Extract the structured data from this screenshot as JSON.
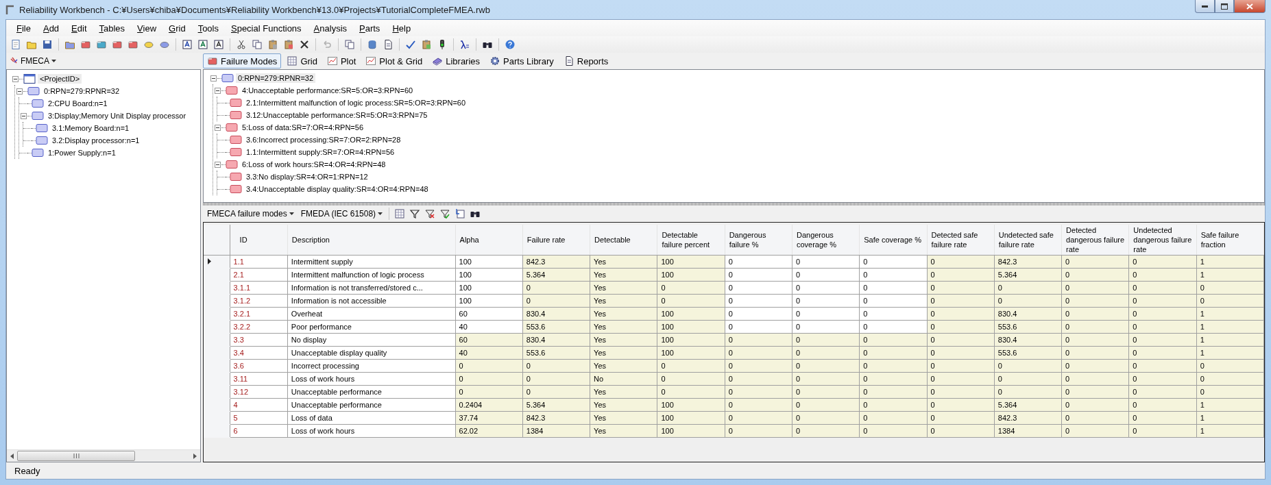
{
  "window": {
    "title": "Reliability Workbench - C:¥Users¥chiba¥Documents¥Reliability Workbench¥13.0¥Projects¥TutorialCompleteFMEA.rwb"
  },
  "menu": [
    "File",
    "Add",
    "Edit",
    "Tables",
    "View",
    "Grid",
    "Tools",
    "Special Functions",
    "Analysis",
    "Parts",
    "Help"
  ],
  "sidebar": {
    "dropdown": "FMECA",
    "tree": [
      {
        "label": "<ProjectID>",
        "kind": "project",
        "selected": true,
        "expanded": true,
        "children": [
          {
            "label": "0:RPN=279:RPNR=32",
            "kind": "block",
            "selected": false,
            "expanded": true,
            "children": [
              {
                "label": "2:CPU Board:n=1",
                "kind": "block",
                "selected": false
              },
              {
                "label": "3:Display;Memory Unit Display processor",
                "kind": "block",
                "selected": false,
                "expanded": true,
                "children": [
                  {
                    "label": "3.1:Memory Board:n=1",
                    "kind": "block",
                    "selected": false
                  },
                  {
                    "label": "3.2:Display processor:n=1",
                    "kind": "block",
                    "selected": false
                  }
                ]
              },
              {
                "label": "1:Power Supply:n=1",
                "kind": "block",
                "selected": false
              }
            ]
          }
        ]
      }
    ]
  },
  "tabs": [
    {
      "label": "Failure Modes",
      "selected": true
    },
    {
      "label": "Grid",
      "selected": false
    },
    {
      "label": "Plot",
      "selected": false
    },
    {
      "label": "Plot & Grid",
      "selected": false
    },
    {
      "label": "Libraries",
      "selected": false
    },
    {
      "label": "Parts Library",
      "selected": false
    },
    {
      "label": "Reports",
      "selected": false
    }
  ],
  "failure_tree": [
    {
      "label": "0:RPN=279:RPNR=32",
      "kind": "block",
      "selected": true,
      "expanded": true,
      "children": [
        {
          "label": "4:Unacceptable performance:SR=5:OR=3:RPN=60",
          "kind": "failure",
          "selected": false,
          "expanded": true,
          "children": [
            {
              "label": "2.1:Intermittent malfunction of logic process:SR=5:OR=3:RPN=60",
              "kind": "failure",
              "selected": false
            },
            {
              "label": "3.12:Unacceptable performance:SR=5:OR=3:RPN=75",
              "kind": "failure",
              "selected": false
            }
          ]
        },
        {
          "label": "5:Loss of data:SR=7:OR=4:RPN=56",
          "kind": "failure",
          "selected": false,
          "expanded": true,
          "children": [
            {
              "label": "3.6:Incorrect processing:SR=7:OR=2:RPN=28",
              "kind": "failure",
              "selected": false
            },
            {
              "label": "1.1:Intermittent supply:SR=7:OR=4:RPN=56",
              "kind": "failure",
              "selected": false
            }
          ]
        },
        {
          "label": "6:Loss of work hours:SR=4:OR=4:RPN=48",
          "kind": "failure",
          "selected": false,
          "expanded": true,
          "children": [
            {
              "label": "3.3:No display:SR=4:OR=1:RPN=12",
              "kind": "failure",
              "selected": false
            },
            {
              "label": "3.4:Unacceptable display quality:SR=4:OR=4:RPN=48",
              "kind": "failure",
              "selected": false
            }
          ]
        }
      ]
    }
  ],
  "grid_toolbar": {
    "view_dropdown": "FMECA failure modes",
    "standard_dropdown": "FMEDA (IEC 61508)"
  },
  "table": {
    "columns": [
      {
        "label": "ID",
        "kind": "id"
      },
      {
        "label": "Description",
        "kind": "text"
      },
      {
        "label": "Alpha",
        "kind": "input"
      },
      {
        "label": "Failure rate",
        "kind": "computed"
      },
      {
        "label": "Detectable",
        "kind": "computed"
      },
      {
        "label": "Detectable failure percent",
        "kind": "computed"
      },
      {
        "label": "Dangerous failure %",
        "kind": "input"
      },
      {
        "label": "Dangerous coverage %",
        "kind": "input"
      },
      {
        "label": "Safe coverage %",
        "kind": "input"
      },
      {
        "label": "Detected safe failure rate",
        "kind": "computed"
      },
      {
        "label": "Undetected safe failure rate",
        "kind": "computed"
      },
      {
        "label": "Detected dangerous failure rate",
        "kind": "computed"
      },
      {
        "label": "Undetected dangerous failure rate",
        "kind": "computed"
      },
      {
        "label": "Safe failure fraction",
        "kind": "computed"
      }
    ],
    "rows": [
      {
        "current": true,
        "locked": false,
        "cells": [
          "1.1",
          "Intermittent supply",
          "100",
          "842.3",
          "Yes",
          "100",
          "0",
          "0",
          "0",
          "0",
          "842.3",
          "0",
          "0",
          "1"
        ]
      },
      {
        "current": false,
        "locked": false,
        "cells": [
          "2.1",
          "Intermittent malfunction of logic process",
          "100",
          "5.364",
          "Yes",
          "100",
          "0",
          "0",
          "0",
          "0",
          "5.364",
          "0",
          "0",
          "1"
        ]
      },
      {
        "current": false,
        "locked": false,
        "cells": [
          "3.1.1",
          "Information is not transferred/stored c...",
          "100",
          "0",
          "Yes",
          "0",
          "0",
          "0",
          "0",
          "0",
          "0",
          "0",
          "0",
          "0"
        ]
      },
      {
        "current": false,
        "locked": false,
        "cells": [
          "3.1.2",
          "Information is not accessible",
          "100",
          "0",
          "Yes",
          "0",
          "0",
          "0",
          "0",
          "0",
          "0",
          "0",
          "0",
          "0"
        ]
      },
      {
        "current": false,
        "locked": false,
        "cells": [
          "3.2.1",
          "Overheat",
          "60",
          "830.4",
          "Yes",
          "100",
          "0",
          "0",
          "0",
          "0",
          "830.4",
          "0",
          "0",
          "1"
        ]
      },
      {
        "current": false,
        "locked": false,
        "cells": [
          "3.2.2",
          "Poor performance",
          "40",
          "553.6",
          "Yes",
          "100",
          "0",
          "0",
          "0",
          "0",
          "553.6",
          "0",
          "0",
          "1"
        ]
      },
      {
        "current": false,
        "locked": true,
        "cells": [
          "3.3",
          "No display",
          "60",
          "830.4",
          "Yes",
          "100",
          "0",
          "0",
          "0",
          "0",
          "830.4",
          "0",
          "0",
          "1"
        ]
      },
      {
        "current": false,
        "locked": true,
        "cells": [
          "3.4",
          "Unacceptable display quality",
          "40",
          "553.6",
          "Yes",
          "100",
          "0",
          "0",
          "0",
          "0",
          "553.6",
          "0",
          "0",
          "1"
        ]
      },
      {
        "current": false,
        "locked": true,
        "cells": [
          "3.6",
          "Incorrect processing",
          "0",
          "0",
          "Yes",
          "0",
          "0",
          "0",
          "0",
          "0",
          "0",
          "0",
          "0",
          "0"
        ]
      },
      {
        "current": false,
        "locked": true,
        "cells": [
          "3.11",
          "Loss of work hours",
          "0",
          "0",
          "No",
          "0",
          "0",
          "0",
          "0",
          "0",
          "0",
          "0",
          "0",
          "0"
        ]
      },
      {
        "current": false,
        "locked": true,
        "cells": [
          "3.12",
          "Unacceptable performance",
          "0",
          "0",
          "Yes",
          "0",
          "0",
          "0",
          "0",
          "0",
          "0",
          "0",
          "0",
          "0"
        ]
      },
      {
        "current": false,
        "locked": true,
        "cells": [
          "4",
          "Unacceptable performance",
          "0.2404",
          "5.364",
          "Yes",
          "100",
          "0",
          "0",
          "0",
          "0",
          "5.364",
          "0",
          "0",
          "1"
        ]
      },
      {
        "current": false,
        "locked": true,
        "cells": [
          "5",
          "Loss of data",
          "37.74",
          "842.3",
          "Yes",
          "100",
          "0",
          "0",
          "0",
          "0",
          "842.3",
          "0",
          "0",
          "1"
        ]
      },
      {
        "current": false,
        "locked": true,
        "cells": [
          "6",
          "Loss of work hours",
          "62.02",
          "1384",
          "Yes",
          "100",
          "0",
          "0",
          "0",
          "0",
          "1384",
          "0",
          "0",
          "1"
        ]
      }
    ]
  },
  "status_bar": "Ready"
}
